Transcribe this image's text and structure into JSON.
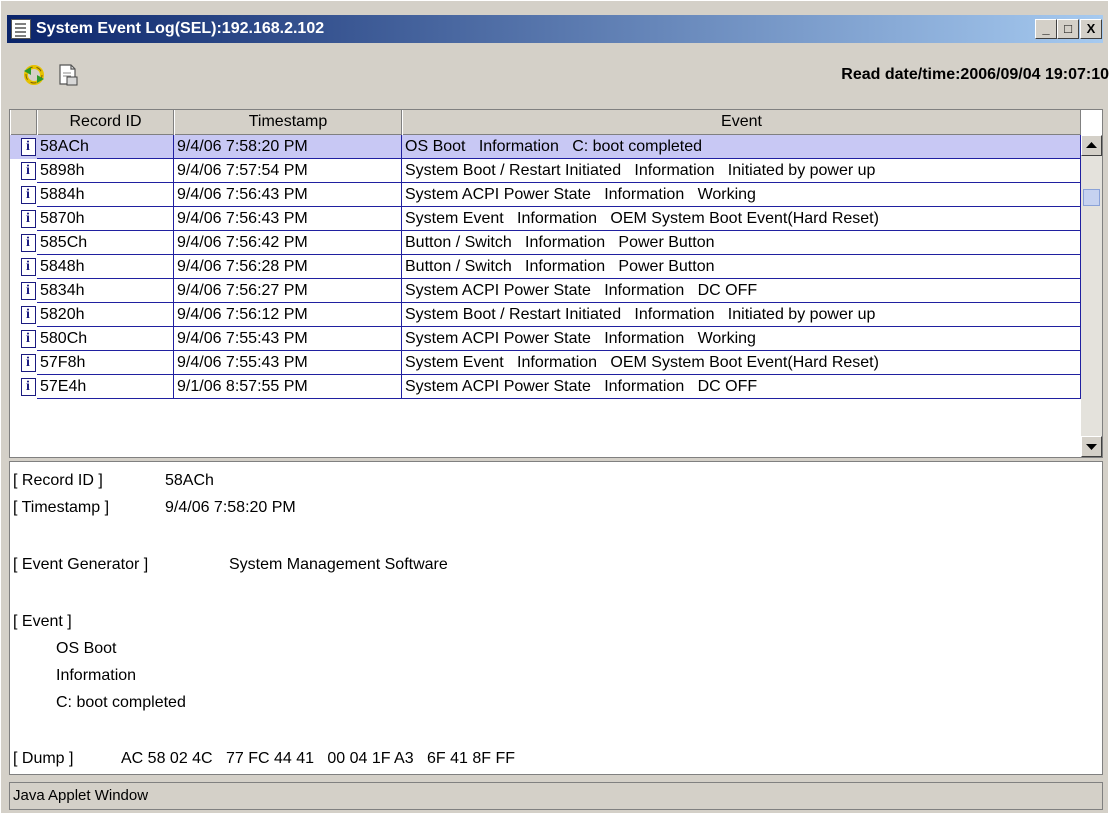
{
  "window": {
    "title": "System Event Log(SEL):192.168.2.102",
    "buttons": [
      "_",
      "□",
      "X"
    ]
  },
  "toolbar": {
    "refresh_icon": "refresh-icon",
    "save_icon": "save-icon",
    "read_datetime": "Read date/time:2006/09/04 19:07:10"
  },
  "table": {
    "columns": [
      "Record ID",
      "Timestamp",
      "Event"
    ],
    "rows": [
      {
        "id": "58ACh",
        "ts": "9/4/06 7:58:20 PM",
        "event": "OS Boot   Information   C: boot completed"
      },
      {
        "id": "5898h",
        "ts": "9/4/06 7:57:54 PM",
        "event": "System Boot / Restart Initiated   Information   Initiated by power up"
      },
      {
        "id": "5884h",
        "ts": "9/4/06 7:56:43 PM",
        "event": "System ACPI Power State   Information   Working"
      },
      {
        "id": "5870h",
        "ts": "9/4/06 7:56:43 PM",
        "event": "System Event   Information   OEM System Boot Event(Hard Reset)"
      },
      {
        "id": "585Ch",
        "ts": "9/4/06 7:56:42 PM",
        "event": "Button / Switch   Information   Power Button"
      },
      {
        "id": "5848h",
        "ts": "9/4/06 7:56:28 PM",
        "event": "Button / Switch   Information   Power Button"
      },
      {
        "id": "5834h",
        "ts": "9/4/06 7:56:27 PM",
        "event": "System ACPI Power State   Information   DC OFF"
      },
      {
        "id": "5820h",
        "ts": "9/4/06 7:56:12 PM",
        "event": "System Boot / Restart Initiated   Information   Initiated by power up"
      },
      {
        "id": "580Ch",
        "ts": "9/4/06 7:55:43 PM",
        "event": "System ACPI Power State   Information   Working"
      },
      {
        "id": "57F8h",
        "ts": "9/4/06 7:55:43 PM",
        "event": "System Event   Information   OEM System Boot Event(Hard Reset)"
      },
      {
        "id": "57E4h",
        "ts": "9/1/06 8:57:55 PM",
        "event": "System ACPI Power State   Information   DC OFF"
      }
    ],
    "selected_index": 0,
    "row_icon": "info-icon"
  },
  "detail": {
    "record_id_label": "[ Record ID ]",
    "record_id": "58ACh",
    "timestamp_label": "[ Timestamp ]",
    "timestamp": "9/4/06 7:58:20 PM",
    "generator_label": "[ Event Generator ]",
    "generator": "System Management Software",
    "event_label": "[ Event ]",
    "event_lines": [
      "OS Boot",
      "Information",
      "C: boot completed"
    ],
    "dump_label": "[ Dump ]",
    "dump": "AC 58 02 4C   77 FC 44 41   00 04 1F A3   6F 41 8F FF"
  },
  "status_bar": {
    "text": "Java Applet Window"
  }
}
